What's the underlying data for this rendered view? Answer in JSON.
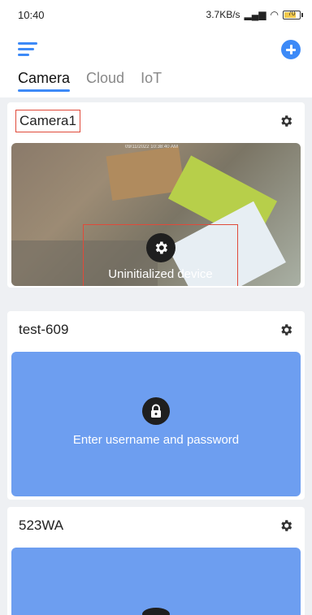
{
  "status_bar": {
    "time": "10:40",
    "network_speed": "3.7KB/s",
    "battery_level": "70"
  },
  "top_bar": {
    "menu_icon": "menu-icon",
    "add_icon": "add-circle-icon",
    "accent_color": "#3d8af7"
  },
  "tabs": [
    {
      "label": "Camera",
      "active": true
    },
    {
      "label": "Cloud",
      "active": false
    },
    {
      "label": "IoT",
      "active": false
    }
  ],
  "devices": [
    {
      "name": "Camera1",
      "status_text": "Uninitialized device",
      "status_icon": "gear-icon",
      "preview_stamp": "09/11/2022 10:38:40 AM"
    },
    {
      "name": "test-609",
      "status_text": "Enter username and password",
      "status_icon": "lock-icon",
      "panel_color": "#6d9ef0"
    },
    {
      "name": "523WA",
      "panel_color": "#6d9ef0"
    }
  ]
}
